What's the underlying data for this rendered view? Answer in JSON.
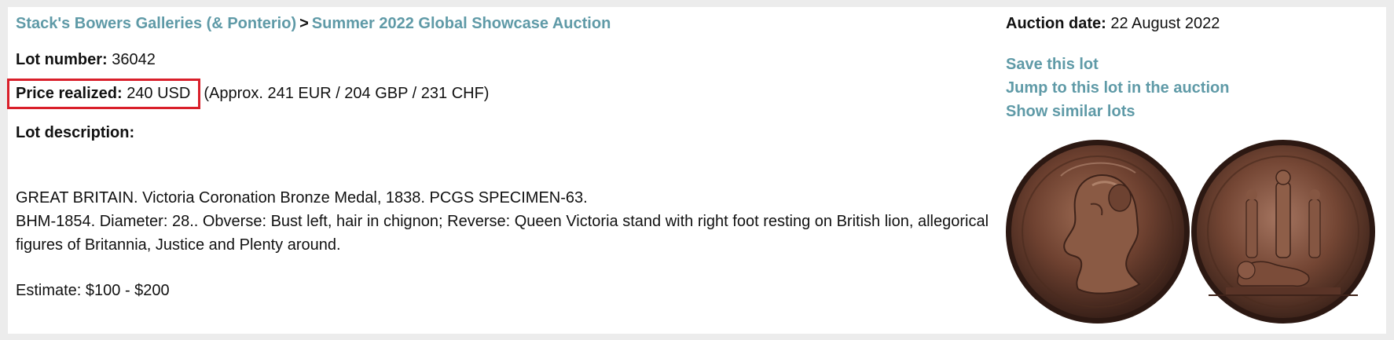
{
  "breadcrumb": {
    "auction_house": "Stack's Bowers Galleries (& Ponterio)",
    "separator": ">",
    "auction_name": "Summer 2022 Global Showcase Auction"
  },
  "lot": {
    "number_label": "Lot number:",
    "number_value": "36042",
    "price_label": "Price realized:",
    "price_value": "240 USD",
    "price_approx": "(Approx. 241 EUR / 204 GBP / 231 CHF)",
    "description_label": "Lot description:",
    "description_lines": [
      "GREAT BRITAIN. Victoria Coronation Bronze Medal, 1838. PCGS SPECIMEN-63.",
      "BHM-1854. Diameter: 28.. Obverse: Bust left, hair in chignon; Reverse: Queen Victoria stand with right foot resting on British lion, allegorical figures of Britannia, Justice and Plenty around."
    ],
    "estimate": "Estimate: $100 - $200"
  },
  "sidebar": {
    "auction_date_label": "Auction date:",
    "auction_date_value": "22 August 2022",
    "links": {
      "save": "Save this lot",
      "jump": "Jump to this lot in the auction",
      "similar": "Show similar lots"
    }
  },
  "colors": {
    "link": "#5f9aa7",
    "highlight_border": "#d91f2a",
    "bronze": "#7a4a35"
  },
  "icons": {
    "coin_image": "bronze-medal-obverse-reverse"
  }
}
